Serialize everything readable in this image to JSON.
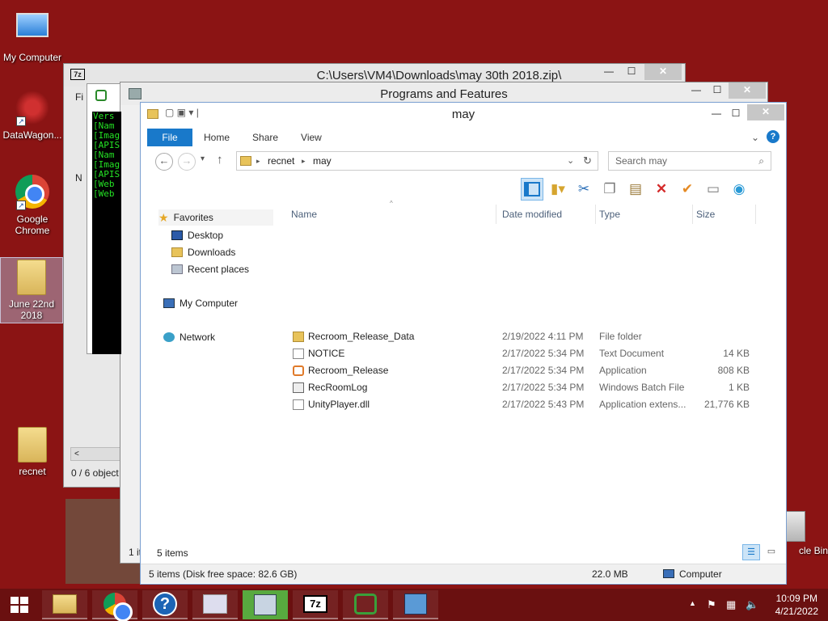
{
  "desktop": {
    "icons": [
      {
        "label": "My Computer",
        "icon": "monitor-icon"
      },
      {
        "label": "DataWagon...",
        "icon": "virus-icon"
      },
      {
        "label": "Google Chrome",
        "icon": "chrome-icon"
      },
      {
        "label": "June 22nd 2018",
        "icon": "folder-icon"
      },
      {
        "label": "recnet",
        "icon": "folder-icon"
      },
      {
        "label": "cle Bin",
        "icon": "recycle-bin-icon"
      }
    ]
  },
  "win7z": {
    "title": "C:\\Users\\VM4\\Downloads\\may 30th 2018.zip\\",
    "status": "0 / 6 object",
    "console_lines": [
      "Vers",
      "[Nam",
      "[Imag",
      "[APIS",
      "[Nam",
      "[Imag",
      "[APIS",
      "[Web",
      "[Web"
    ]
  },
  "winpf": {
    "title": "Programs and Features",
    "status": "1 it"
  },
  "winmay": {
    "title": "may",
    "tabs": [
      "File",
      "Home",
      "Share",
      "View"
    ],
    "address": [
      "recnet",
      "may"
    ],
    "search_placeholder": "Search may",
    "nav": {
      "favorites": "Favorites",
      "desktop": "Desktop",
      "downloads": "Downloads",
      "recent": "Recent places",
      "mycomputer": "My Computer",
      "network": "Network"
    },
    "columns": [
      "Name",
      "Date modified",
      "Type",
      "Size"
    ],
    "files": [
      {
        "name": "Recroom_Release_Data",
        "date": "2/19/2022 4:11 PM",
        "type": "File folder",
        "size": "",
        "icon": "folder-icon"
      },
      {
        "name": "NOTICE",
        "date": "2/17/2022 5:34 PM",
        "type": "Text Document",
        "size": "14 KB",
        "icon": "text-file-icon"
      },
      {
        "name": "Recroom_Release",
        "date": "2/17/2022 5:34 PM",
        "type": "Application",
        "size": "808 KB",
        "icon": "app-icon"
      },
      {
        "name": "RecRoomLog",
        "date": "2/17/2022 5:34 PM",
        "type": "Windows Batch File",
        "size": "1 KB",
        "icon": "batch-file-icon"
      },
      {
        "name": "UnityPlayer.dll",
        "date": "2/17/2022 5:43 PM",
        "type": "Application extens...",
        "size": "21,776 KB",
        "icon": "dll-file-icon"
      }
    ],
    "items_count": "5 items",
    "status_left": "5 items (Disk free space: 82.6 GB)",
    "status_size": "22.0 MB",
    "status_location": "Computer"
  },
  "taskbar": {
    "clock_time": "10:09 PM",
    "clock_date": "4/21/2022",
    "apps": [
      "file-explorer-icon",
      "chrome-icon",
      "help-icon",
      "task-manager-icon",
      "programs-icon",
      "7zip-icon",
      "recroom-icon",
      "control-panel-icon"
    ]
  }
}
